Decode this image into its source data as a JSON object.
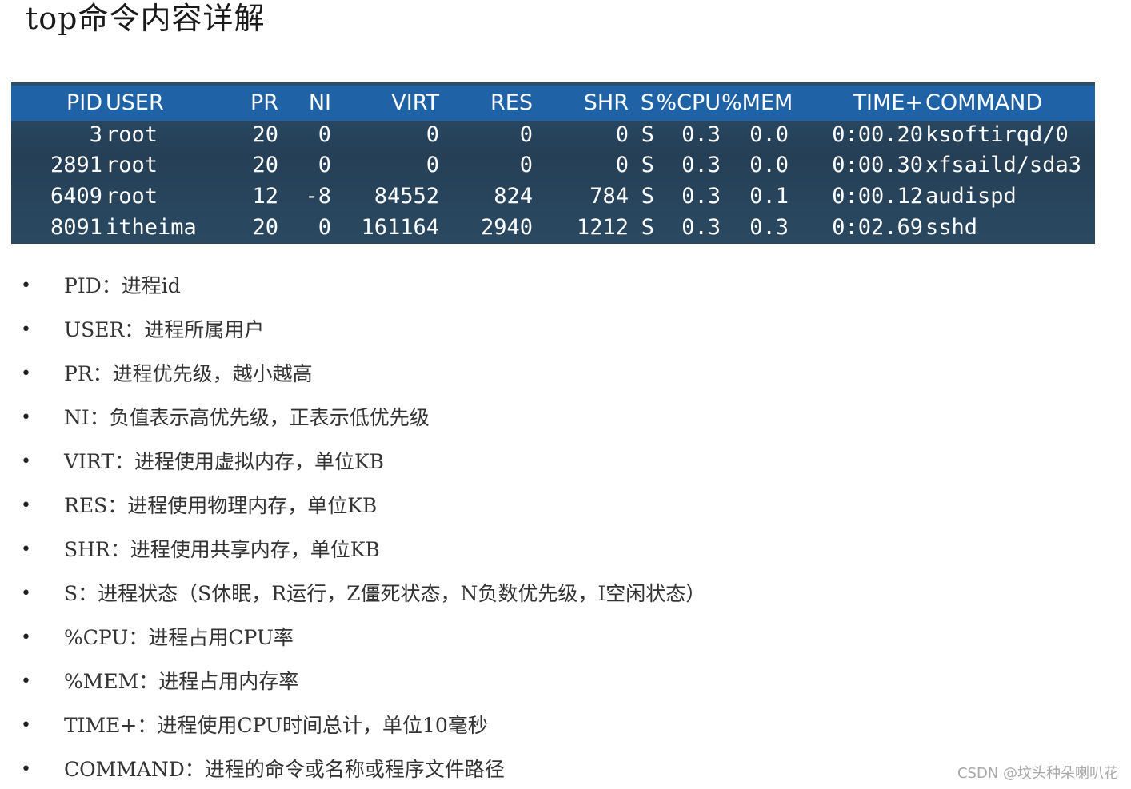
{
  "page": {
    "title": "top命令内容详解"
  },
  "top_output": {
    "headers": [
      "PID",
      "USER",
      "PR",
      "NI",
      "VIRT",
      "RES",
      "SHR",
      "S",
      "%CPU",
      "%MEM",
      "TIME+",
      "COMMAND"
    ],
    "rows": [
      [
        "3",
        "root",
        "20",
        "0",
        "0",
        "0",
        "0",
        "S",
        "0.3",
        "0.0",
        "0:00.20",
        "ksoftirqd/0"
      ],
      [
        "2891",
        "root",
        "20",
        "0",
        "0",
        "0",
        "0",
        "S",
        "0.3",
        "0.0",
        "0:00.30",
        "xfsaild/sda3"
      ],
      [
        "6409",
        "root",
        "12",
        "-8",
        "84552",
        "824",
        "784",
        "S",
        "0.3",
        "0.1",
        "0:00.12",
        "audispd"
      ],
      [
        "8091",
        "itheima",
        "20",
        "0",
        "161164",
        "2940",
        "1212",
        "S",
        "0.3",
        "0.3",
        "0:02.69",
        "sshd"
      ]
    ],
    "header_color": "#1f63a6",
    "body_color": "#2c4f6b",
    "text_color": "#ffffff"
  },
  "explanations": [
    "PID：进程id",
    "USER：进程所属用户",
    "PR：进程优先级，越小越高",
    "NI：负值表示高优先级，正表示低优先级",
    "VIRT：进程使用虚拟内存，单位KB",
    "RES：进程使用物理内存，单位KB",
    "SHR：进程使用共享内存，单位KB",
    "S：进程状态（S休眠，R运行，Z僵死状态，N负数优先级，I空闲状态）",
    "%CPU：进程占用CPU率",
    "%MEM：进程占用内存率",
    "TIME+：进程使用CPU时间总计，单位10毫秒",
    "COMMAND：进程的命令或名称或程序文件路径"
  ],
  "bullet_symbol": "•",
  "watermark": "CSDN @坟头种朵喇叭花"
}
